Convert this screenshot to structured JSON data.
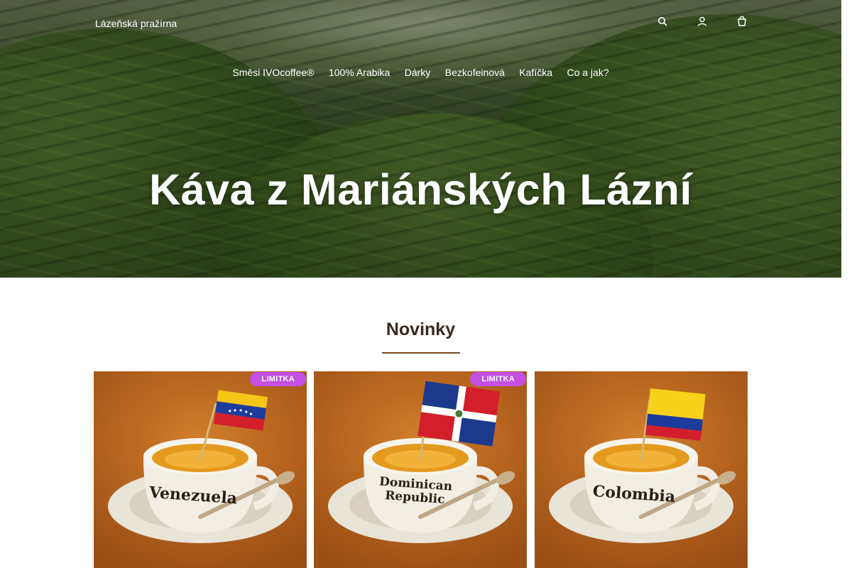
{
  "header": {
    "brand": "Lázeňská pražírna",
    "icons": [
      "search-icon",
      "user-icon",
      "cart-icon"
    ]
  },
  "nav": {
    "items": [
      {
        "label": "Směsi IVOcoffee®"
      },
      {
        "label": "100% Arabika"
      },
      {
        "label": "Dárky"
      },
      {
        "label": "Bezkofeinová"
      },
      {
        "label": "Kafíčka"
      },
      {
        "label": "Co a jak?"
      }
    ]
  },
  "hero": {
    "title": "Káva z Mariánských Lázní"
  },
  "section": {
    "title": "Novinky"
  },
  "products": [
    {
      "badge": "LIMITKA",
      "cup_text": "Venezuela",
      "flag": "venezuela"
    },
    {
      "badge": "LIMITKA",
      "cup_text_1": "Dominican",
      "cup_text_2": "Republic",
      "flag": "dominican-republic"
    },
    {
      "cup_text": "Colombia",
      "flag": "colombia"
    }
  ],
  "colors": {
    "accent_rule": "#7a4a20",
    "badge": "#c54fe3",
    "card_bg": "#b9661f"
  }
}
